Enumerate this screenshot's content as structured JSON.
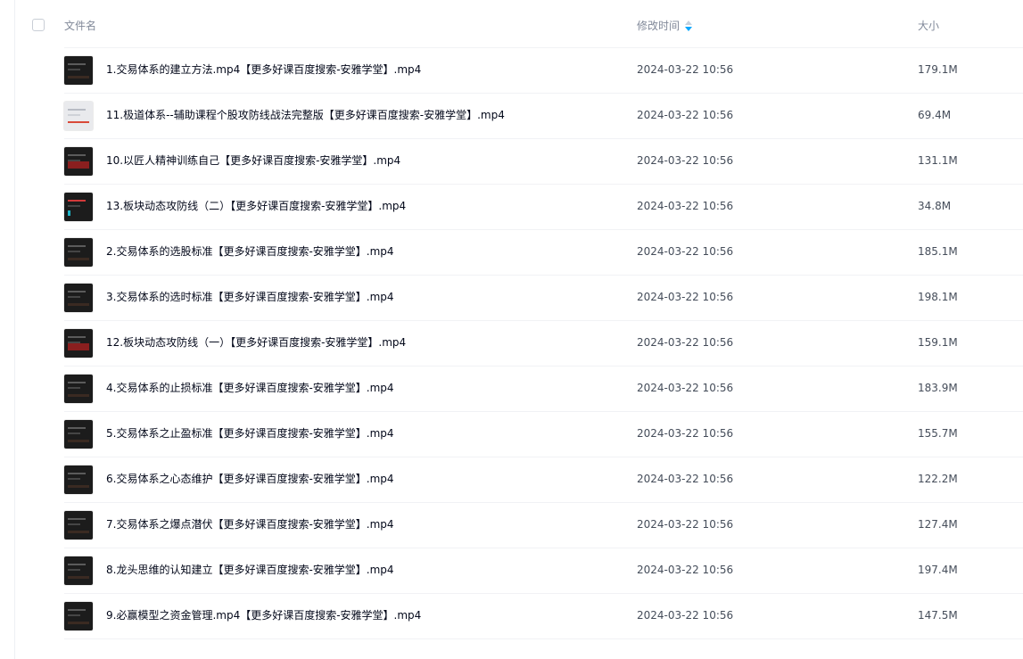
{
  "header": {
    "name_label": "文件名",
    "time_label": "修改时间",
    "size_label": "大小"
  },
  "files": [
    {
      "name": "1.交易体系的建立方法.mp4【更多好课百度搜索-安雅学堂】.mp4",
      "time": "2024-03-22 10:56",
      "size": "179.1M"
    },
    {
      "name": "11.极道体系--辅助课程个股攻防线战法完整版【更多好课百度搜索-安雅学堂】.mp4",
      "time": "2024-03-22 10:56",
      "size": "69.4M"
    },
    {
      "name": "10.以匠人精神训练自己【更多好课百度搜索-安雅学堂】.mp4",
      "time": "2024-03-22 10:56",
      "size": "131.1M"
    },
    {
      "name": "13.板块动态攻防线（二）【更多好课百度搜索-安雅学堂】.mp4",
      "time": "2024-03-22 10:56",
      "size": "34.8M"
    },
    {
      "name": "2.交易体系的选股标准【更多好课百度搜索-安雅学堂】.mp4",
      "time": "2024-03-22 10:56",
      "size": "185.1M"
    },
    {
      "name": "3.交易体系的选时标准【更多好课百度搜索-安雅学堂】.mp4",
      "time": "2024-03-22 10:56",
      "size": "198.1M"
    },
    {
      "name": "12.板块动态攻防线（一）【更多好课百度搜索-安雅学堂】.mp4",
      "time": "2024-03-22 10:56",
      "size": "159.1M"
    },
    {
      "name": "4.交易体系的止损标准【更多好课百度搜索-安雅学堂】.mp4",
      "time": "2024-03-22 10:56",
      "size": "183.9M"
    },
    {
      "name": "5.交易体系之止盈标准【更多好课百度搜索-安雅学堂】.mp4",
      "time": "2024-03-22 10:56",
      "size": "155.7M"
    },
    {
      "name": "6.交易体系之心态维护【更多好课百度搜索-安雅学堂】.mp4",
      "time": "2024-03-22 10:56",
      "size": "122.2M"
    },
    {
      "name": "7.交易体系之爆点潜伏【更多好课百度搜索-安雅学堂】.mp4",
      "time": "2024-03-22 10:56",
      "size": "127.4M"
    },
    {
      "name": "8.龙头思维的认知建立【更多好课百度搜索-安雅学堂】.mp4",
      "time": "2024-03-22 10:56",
      "size": "197.4M"
    },
    {
      "name": "9.必赢模型之资金管理.mp4【更多好课百度搜索-安雅学堂】.mp4",
      "time": "2024-03-22 10:56",
      "size": "147.5M"
    }
  ],
  "colors": {
    "sort_active": "#06a7ff",
    "header_text": "#818999",
    "row_text": "#03081a",
    "meta_text": "#454d5a"
  },
  "icons": {
    "checkbox": "checkbox-icon",
    "sort": "sort-desc-icon",
    "thumbnail": "video-thumbnail-icon"
  }
}
